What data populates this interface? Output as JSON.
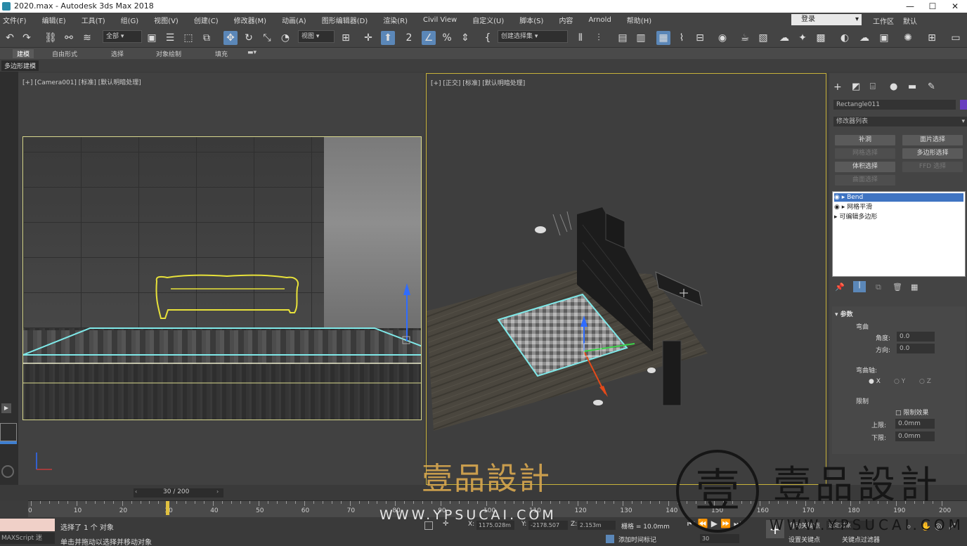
{
  "title": "2020.max - Autodesk 3ds Max 2018",
  "window_buttons": [
    "—",
    "☐",
    "✕"
  ],
  "menu": [
    "文件(F)",
    "编辑(E)",
    "工具(T)",
    "组(G)",
    "视图(V)",
    "创建(C)",
    "修改器(M)",
    "动画(A)",
    "图形编辑器(D)",
    "渲染(R)",
    "Civil View",
    "自定义(U)",
    "脚本(S)",
    "内容",
    "Arnold",
    "帮助(H)"
  ],
  "login": "登录",
  "workspace_label": "工作区",
  "workspace_value": "默认",
  "toolbar": {
    "filter": "全部",
    "view": "视图",
    "selection_set": "创建选择集"
  },
  "ribbon": [
    "建模",
    "自由形式",
    "选择",
    "对象绘制",
    "填充"
  ],
  "ribbon_sub": "多边形建模",
  "vp1_label": "[+] [Camera001] [标准] [默认明暗处理]",
  "vp2_label": "[+] [正交] [标准] [默认明暗处理]",
  "cmd": {
    "object_name": "Rectangle011",
    "modifier_list": "修改器列表",
    "buttons": [
      "补洞",
      "面片选择",
      "网格选择",
      "多边形选择",
      "体积选择",
      "FFD 选择",
      "曲面选择"
    ],
    "stack": [
      "Bend",
      "网格平滑",
      "可编辑多边形"
    ],
    "rollout": "参数",
    "bend": "弯曲",
    "angle": "角度:",
    "angle_val": "0.0",
    "dir": "方向:",
    "dir_val": "0.0",
    "axis": "弯曲轴:",
    "ax": [
      "X",
      "Y",
      "Z"
    ],
    "limits": "限制",
    "limit_effect": "限制效果",
    "upper": "上限:",
    "upper_val": "0.0mm",
    "lower": "下限:",
    "lower_val": "0.0mm"
  },
  "timeline": {
    "frame": "30 / 200",
    "ticks": [
      "0",
      "10",
      "20",
      "30",
      "40",
      "50",
      "60",
      "70",
      "80",
      "90",
      "100",
      "110",
      "120",
      "130",
      "140",
      "150",
      "160",
      "170",
      "180",
      "190",
      "200"
    ]
  },
  "status": {
    "maxscript": "MAXScript 迷",
    "line1": "选择了 1 个 对象",
    "line2": "单击并拖动以选择并移动对象",
    "x_label": "X:",
    "x": "1175.028m",
    "y_label": "Y:",
    "y": "-2178.507",
    "z_label": "Z:",
    "z": "2.153m",
    "grid": "栅格 = 10.0mm",
    "add_time_tag": "添加时间标记",
    "auto_key": "自动关键点",
    "set_key": "设置关键点",
    "key_filter": "关键点过滤器",
    "frame_field": "30",
    "selected": "选定对象"
  },
  "watermark": {
    "cn": "壹品設計",
    "url": "WWW.YPSUCAI.COM",
    "cn_big": "壹品設計",
    "url_big": "WWW.YPSUCAI.COM",
    "seal_char": "壹"
  }
}
